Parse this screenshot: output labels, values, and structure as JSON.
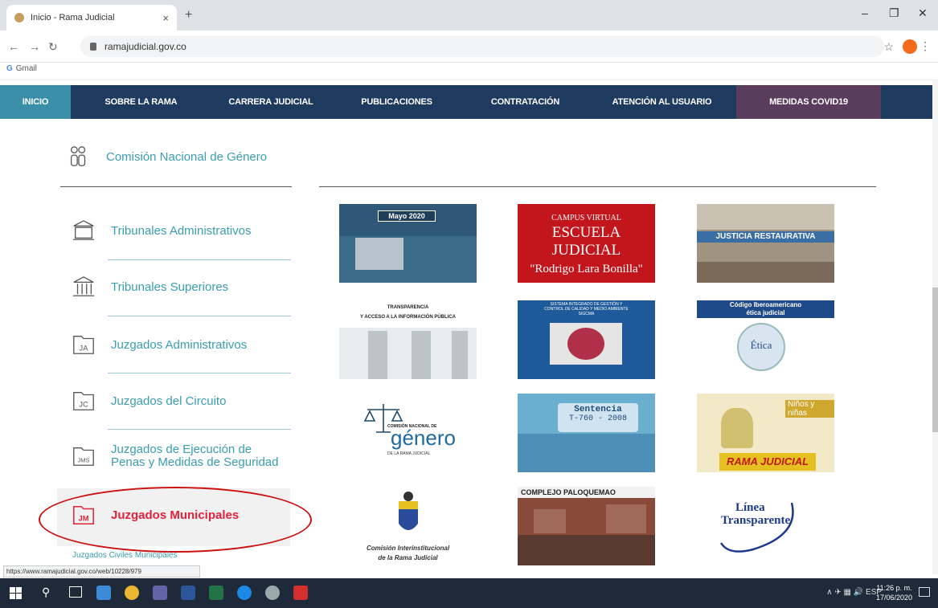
{
  "browser": {
    "tab_title": "Inicio - Rama Judicial",
    "tab_close": "×",
    "new_tab": "+",
    "url": "ramajudicial.gov.co",
    "bookmark": "Gmail",
    "status_url": "https://www.ramajudicial.gov.co/web/10228/979"
  },
  "menu": [
    {
      "label": "INICIO"
    },
    {
      "label": "SOBRE LA RAMA"
    },
    {
      "label": "CARRERA JUDICIAL"
    },
    {
      "label": "PUBLICACIONES"
    },
    {
      "label": "CONTRATACIÓN"
    },
    {
      "label": "ATENCIÓN AL USUARIO"
    },
    {
      "label": "MEDIDAS COVID19"
    }
  ],
  "sidebar": {
    "top": "Comisión Nacional de Género",
    "items": [
      {
        "label": "Tribunales Administrativos"
      },
      {
        "label": "Tribunales Superiores"
      },
      {
        "label": "Juzgados Administrativos",
        "icon": "JA"
      },
      {
        "label": "Juzgados del Circuito",
        "icon": "JC"
      },
      {
        "label": "Juzgados de Ejecución de Penas y Medidas de Seguridad",
        "line1": "Juzgados de Ejecución de",
        "line2": "Penas y Medidas de Seguridad",
        "icon": "JMS"
      },
      {
        "label": "Juzgados Municipales",
        "icon": "JM"
      }
    ],
    "sub": "Juzgados Civiles Municipales"
  },
  "cards": {
    "mayo": "Mayo 2020",
    "campus1": "CAMPUS VIRTUAL",
    "campus2": "ESCUELA JUDICIAL",
    "campus3": "\"Rodrigo Lara Bonilla\"",
    "justicia": "JUSTICIA RESTAURATIVA",
    "transp1": "TRANSPARENCIA",
    "transp2": "Y ACCESO A LA INFORMACIÓN PÚBLICA",
    "sigcma1": "SISTEMA INTEGRADO DE GESTIÓN Y",
    "sigcma2": "CONTROL DE CALIDAD Y MEDIO AMBIENTE",
    "sigcma3": "SIGCMA",
    "codigo1": "Código Iberoamericano",
    "codigo2": "ética judicial",
    "etica": "Ética",
    "genero_small": "COMISIÓN NACIONAL DE",
    "genero": "género",
    "genero_sub": "DE LA RAMA JUDICIAL",
    "sentencia": "Sentencia",
    "sentencia_num": "T-760 - 2008",
    "ninos": "Niños y niñas",
    "rama": "RAMA JUDICIAL",
    "cirj1": "Comisión Interinstitucional",
    "cirj2": "de la Rama Judicial",
    "paloquemao": "COMPLEJO PALOQUEMAO",
    "linea": "Línea",
    "transparente": "Transparente"
  },
  "taskbar": {
    "lang": "ESP",
    "time": "11:26 p. m.",
    "date": "17/06/2020"
  }
}
